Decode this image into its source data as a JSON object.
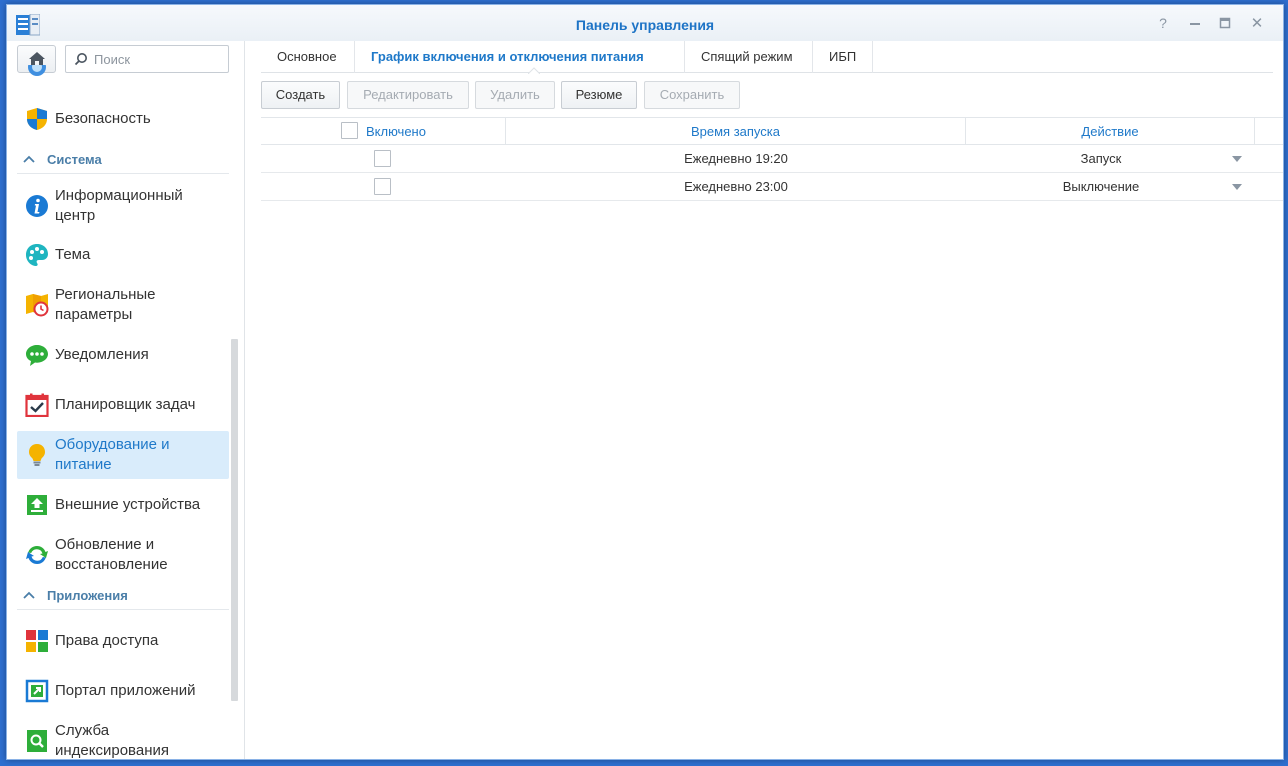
{
  "window": {
    "title": "Панель управления",
    "help_glyph": "?",
    "close_glyph": "✕"
  },
  "sidebar": {
    "search_placeholder": "Поиск",
    "items_top": [
      {
        "label": "Безопасность",
        "icon": "shield-icon"
      }
    ],
    "section_system": "Система",
    "items_system": [
      {
        "label": "Информационный центр",
        "icon": "info-icon"
      },
      {
        "label": "Тема",
        "icon": "palette-icon"
      },
      {
        "label": "Региональные параметры",
        "icon": "map-clock-icon"
      },
      {
        "label": "Уведомления",
        "icon": "chat-bubble-icon"
      },
      {
        "label": "Планировщик задач",
        "icon": "calendar-check-icon"
      },
      {
        "label": "Оборудование и питание",
        "icon": "lightbulb-icon",
        "active": true
      },
      {
        "label": "Внешние устройства",
        "icon": "upload-icon"
      },
      {
        "label": "Обновление и восстановление",
        "icon": "refresh-icon"
      }
    ],
    "section_apps": "Приложения",
    "items_apps": [
      {
        "label": "Права доступа",
        "icon": "apps-grid-icon"
      },
      {
        "label": "Портал приложений",
        "icon": "external-link-icon"
      },
      {
        "label": "Служба индексирования",
        "icon": "search-doc-icon"
      }
    ]
  },
  "tabs": [
    {
      "label": "Основное"
    },
    {
      "label": "График включения и отключения питания",
      "active": true
    },
    {
      "label": "Спящий режим"
    },
    {
      "label": "ИБП"
    }
  ],
  "toolbar": {
    "create": "Создать",
    "edit": "Редактировать",
    "delete": "Удалить",
    "summary": "Резюме",
    "save": "Сохранить"
  },
  "grid": {
    "columns": {
      "enabled": "Включено",
      "start_time": "Время запуска",
      "action": "Действие"
    },
    "rows": [
      {
        "enabled": false,
        "time": "Ежедневно 19:20",
        "action": "Запуск"
      },
      {
        "enabled": false,
        "time": "Ежедневно 23:00",
        "action": "Выключение"
      }
    ]
  },
  "colors": {
    "accent": "#1f79c9",
    "active_bg": "#d9ecfb",
    "desktop": "#2e6fd0"
  }
}
